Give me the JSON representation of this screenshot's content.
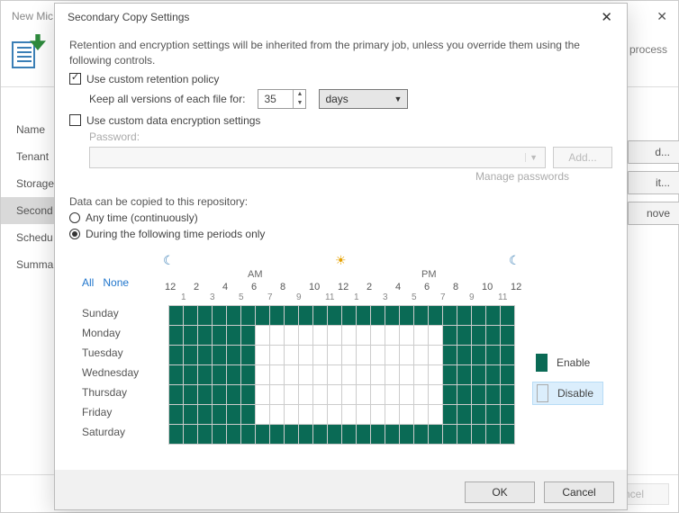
{
  "outer": {
    "title": "New Mic…",
    "right_text": "y process",
    "nav": [
      "Name",
      "Tenant",
      "Storage",
      "Second…",
      "Schedu…",
      "Summa…"
    ],
    "nav_selected": 3,
    "buttons": [
      "d...",
      "it...",
      "nove"
    ],
    "footer": "ncel"
  },
  "modal": {
    "title": "Secondary Copy Settings",
    "intro": "Retention and encryption settings will be inherited from the primary job, unless you override them using the following controls.",
    "use_retention": {
      "checked": true,
      "label": "Use custom retention policy"
    },
    "keep_label": "Keep all versions of each file for:",
    "keep_value": "35",
    "keep_unit": "days",
    "use_encryption": {
      "checked": false,
      "label": "Use custom data encryption settings"
    },
    "password_label": "Password:",
    "add_label": "Add...",
    "manage_label": "Manage passwords",
    "copy_intro": "Data can be copied to this repository:",
    "opt_any": "Any time (continuously)",
    "opt_periods": "During the following time periods only",
    "selected_opt": "periods",
    "all_label": "All",
    "none_label": "None",
    "am_label": "AM",
    "pm_label": "PM",
    "big_hours": [
      "12",
      "2",
      "4",
      "6",
      "8",
      "10",
      "12",
      "2",
      "4",
      "6",
      "8",
      "10",
      "12"
    ],
    "small_hours": [
      "1",
      "3",
      "5",
      "7",
      "9",
      "11",
      "1",
      "3",
      "5",
      "7",
      "9",
      "11"
    ],
    "days": [
      "Sunday",
      "Monday",
      "Tuesday",
      "Wednesday",
      "Thursday",
      "Friday",
      "Saturday"
    ],
    "legend_enable": "Enable",
    "legend_disable": "Disable",
    "ok": "OK",
    "cancel": "Cancel"
  },
  "chart_data": {
    "type": "heatmap",
    "rows": [
      "Sunday",
      "Monday",
      "Tuesday",
      "Wednesday",
      "Thursday",
      "Friday",
      "Saturday"
    ],
    "cols_hours_start_at": 0,
    "note": "1 = enabled (green), 0 = disabled (white). Columns are 24 hours from 12AM.",
    "schedule": {
      "Sunday": [
        1,
        1,
        1,
        1,
        1,
        1,
        1,
        1,
        1,
        1,
        1,
        1,
        1,
        1,
        1,
        1,
        1,
        1,
        1,
        1,
        1,
        1,
        1,
        1
      ],
      "Monday": [
        1,
        1,
        1,
        1,
        1,
        1,
        0,
        0,
        0,
        0,
        0,
        0,
        0,
        0,
        0,
        0,
        0,
        0,
        0,
        1,
        1,
        1,
        1,
        1
      ],
      "Tuesday": [
        1,
        1,
        1,
        1,
        1,
        1,
        0,
        0,
        0,
        0,
        0,
        0,
        0,
        0,
        0,
        0,
        0,
        0,
        0,
        1,
        1,
        1,
        1,
        1
      ],
      "Wednesday": [
        1,
        1,
        1,
        1,
        1,
        1,
        0,
        0,
        0,
        0,
        0,
        0,
        0,
        0,
        0,
        0,
        0,
        0,
        0,
        1,
        1,
        1,
        1,
        1
      ],
      "Thursday": [
        1,
        1,
        1,
        1,
        1,
        1,
        0,
        0,
        0,
        0,
        0,
        0,
        0,
        0,
        0,
        0,
        0,
        0,
        0,
        1,
        1,
        1,
        1,
        1
      ],
      "Friday": [
        1,
        1,
        1,
        1,
        1,
        1,
        0,
        0,
        0,
        0,
        0,
        0,
        0,
        0,
        0,
        0,
        0,
        0,
        0,
        1,
        1,
        1,
        1,
        1
      ],
      "Saturday": [
        1,
        1,
        1,
        1,
        1,
        1,
        1,
        1,
        1,
        1,
        1,
        1,
        1,
        1,
        1,
        1,
        1,
        1,
        1,
        1,
        1,
        1,
        1,
        1
      ]
    }
  }
}
